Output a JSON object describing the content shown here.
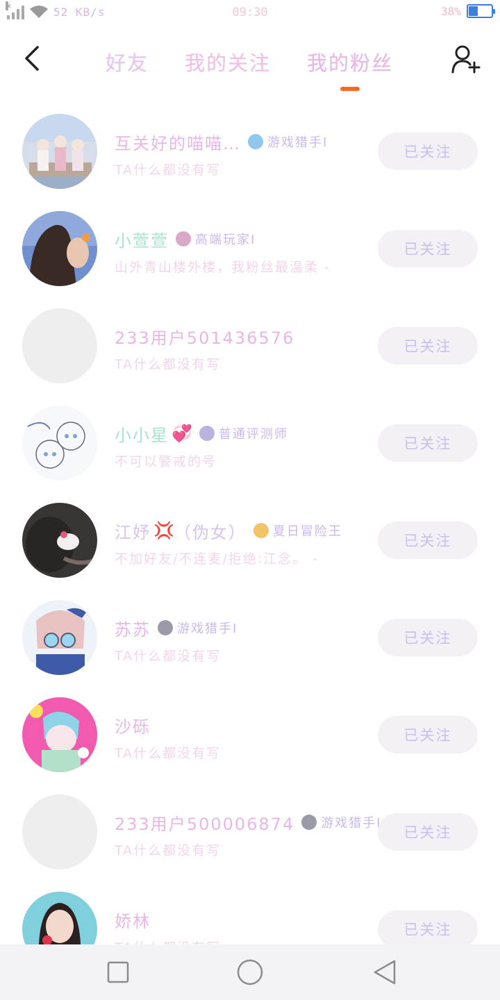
{
  "status_bar": {
    "net_speed": "52 KB/s",
    "time": "09:30",
    "battery_percent": "38%",
    "battery_level": 0.38,
    "signal_icon": "cellular-no-signal-icon",
    "wifi_icon": "wifi-icon",
    "battery_icon": "battery-charging-icon"
  },
  "header": {
    "back_icon": "chevron-left-icon",
    "tabs": [
      {
        "label": "好友"
      },
      {
        "label": "我的关注"
      },
      {
        "label": "我的粉丝"
      }
    ],
    "active_tab": 2,
    "add_friend_icon": "add-user-icon",
    "accent_color": "#ff6a1f"
  },
  "fans": [
    {
      "name": "互关好的喵喵…",
      "emoji": "",
      "badge": "游戏猎手Ⅰ",
      "bio": "TA什么都没有写",
      "button": "已关注"
    },
    {
      "name": "小萱萱",
      "emoji": "",
      "badge": "高端玩家Ⅰ",
      "bio": "山外青山楼外楼，我粉丝最温柔 -",
      "button": "已关注"
    },
    {
      "name": "233用户501436576",
      "emoji": "",
      "badge": "",
      "bio": "TA什么都没有写",
      "button": "已关注"
    },
    {
      "name": "小小星",
      "emoji": "💞",
      "badge": "普通评测师",
      "bio": "不可以警戒的号",
      "button": "已关注"
    },
    {
      "name": "江妤",
      "emoji": "💢",
      "name_suffix": "（伪女）",
      "badge": "夏日冒险王",
      "bio": "不加好友/不连麦/拒绝:江念。 -",
      "button": "已关注"
    },
    {
      "name": "苏苏",
      "emoji": "",
      "badge": "游戏猎手Ⅰ",
      "bio": "TA什么都没有写",
      "button": "已关注"
    },
    {
      "name": "沙砾",
      "emoji": "",
      "badge": "",
      "bio": "TA什么都没有写",
      "button": "已关注"
    },
    {
      "name": "233用户500006874",
      "emoji": "",
      "badge": "游戏猎手Ⅰ",
      "bio": "TA什么都没有写",
      "button": "已关注"
    },
    {
      "name": "娇林",
      "emoji": "",
      "badge": "",
      "bio": "TA什么都没有写",
      "button": "已关注"
    }
  ],
  "nav_bar": {
    "recent_icon": "square-recents-icon",
    "home_icon": "circle-home-icon",
    "back_icon": "triangle-back-icon"
  }
}
